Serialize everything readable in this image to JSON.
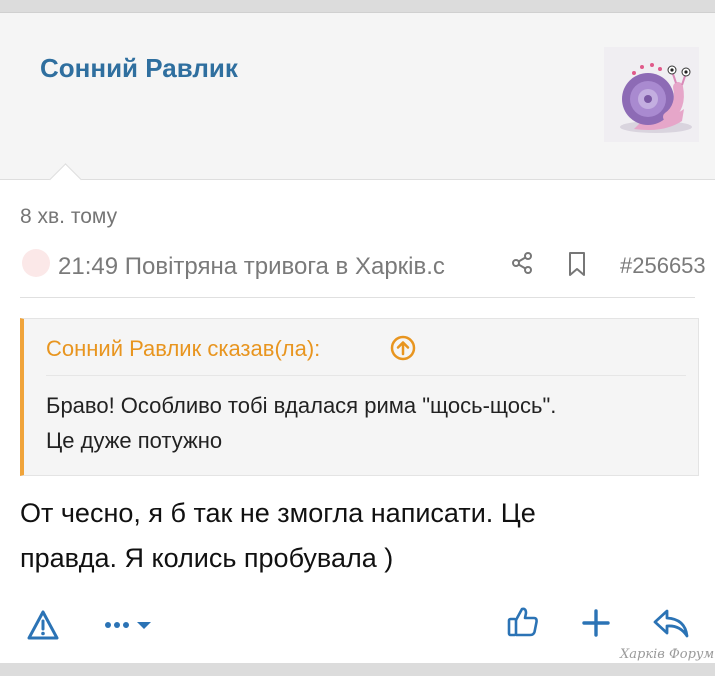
{
  "post": {
    "username": "Сонний Равлик",
    "time_ago": "8 хв. тому",
    "thread_title": "21:49 Повітряна тривога в Харків.с",
    "post_number": "#256653",
    "quote": {
      "author_line": "Сонний Равлик сказав(ла):",
      "text_line1": "Браво! Особливо тобі вдалася рима \"щось-щось\".",
      "text_line2": "Це дуже потужно"
    },
    "message_line1": "От чесно, я б так не змогла написати. Це",
    "message_line2": "правда. Я колись пробувала )"
  },
  "actions": {
    "report_icon": "warning-icon",
    "more_icon": "ellipsis-icon",
    "like_icon": "thumbs-up-icon",
    "add_icon": "plus-icon",
    "reply_icon": "reply-icon"
  },
  "watermark": "Харків Форум",
  "colors": {
    "username": "#2f6f9f",
    "quote_accent": "#f0a43b",
    "icon_blue": "#2b73b5"
  }
}
